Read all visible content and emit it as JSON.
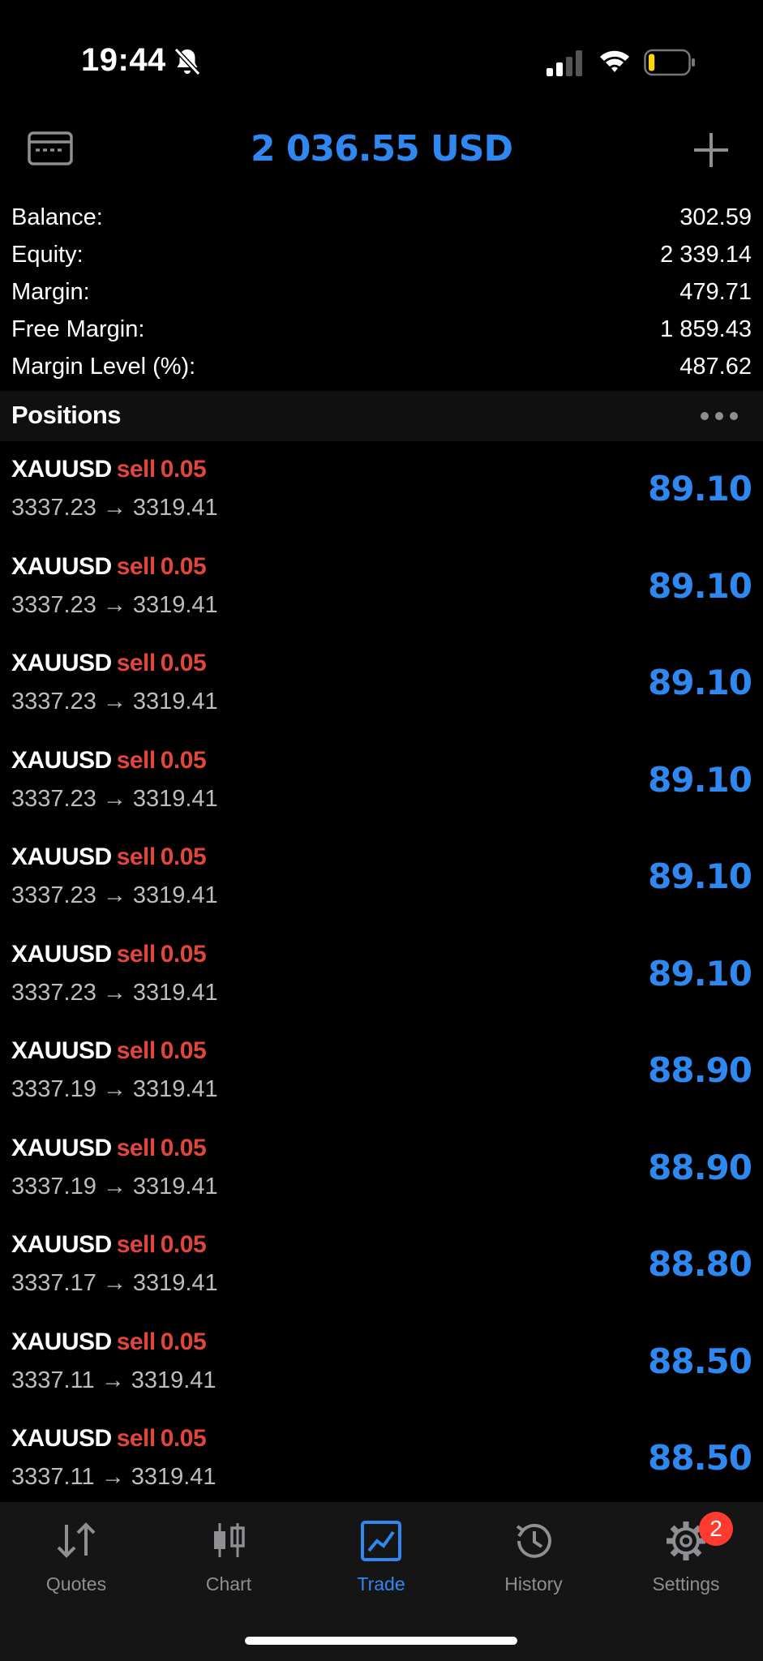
{
  "status_bar": {
    "time": "19:44"
  },
  "header": {
    "title": "2 036.55 USD"
  },
  "summary": [
    {
      "label": "Balance:",
      "value": "302.59"
    },
    {
      "label": "Equity:",
      "value": "2 339.14"
    },
    {
      "label": "Margin:",
      "value": "479.71"
    },
    {
      "label": "Free Margin:",
      "value": "1 859.43"
    },
    {
      "label": "Margin Level (%):",
      "value": "487.62"
    }
  ],
  "positions": {
    "title": "Positions",
    "arrow": "→",
    "items": [
      {
        "symbol": "XAUUSD",
        "side": "sell",
        "lot": "0.05",
        "open": "3337.23",
        "current": "3319.41",
        "profit": "89.10"
      },
      {
        "symbol": "XAUUSD",
        "side": "sell",
        "lot": "0.05",
        "open": "3337.23",
        "current": "3319.41",
        "profit": "89.10"
      },
      {
        "symbol": "XAUUSD",
        "side": "sell",
        "lot": "0.05",
        "open": "3337.23",
        "current": "3319.41",
        "profit": "89.10"
      },
      {
        "symbol": "XAUUSD",
        "side": "sell",
        "lot": "0.05",
        "open": "3337.23",
        "current": "3319.41",
        "profit": "89.10"
      },
      {
        "symbol": "XAUUSD",
        "side": "sell",
        "lot": "0.05",
        "open": "3337.23",
        "current": "3319.41",
        "profit": "89.10"
      },
      {
        "symbol": "XAUUSD",
        "side": "sell",
        "lot": "0.05",
        "open": "3337.23",
        "current": "3319.41",
        "profit": "89.10"
      },
      {
        "symbol": "XAUUSD",
        "side": "sell",
        "lot": "0.05",
        "open": "3337.19",
        "current": "3319.41",
        "profit": "88.90"
      },
      {
        "symbol": "XAUUSD",
        "side": "sell",
        "lot": "0.05",
        "open": "3337.19",
        "current": "3319.41",
        "profit": "88.90"
      },
      {
        "symbol": "XAUUSD",
        "side": "sell",
        "lot": "0.05",
        "open": "3337.17",
        "current": "3319.41",
        "profit": "88.80"
      },
      {
        "symbol": "XAUUSD",
        "side": "sell",
        "lot": "0.05",
        "open": "3337.11",
        "current": "3319.41",
        "profit": "88.50"
      },
      {
        "symbol": "XAUUSD",
        "side": "sell",
        "lot": "0.05",
        "open": "3337.11",
        "current": "3319.41",
        "profit": "88.50"
      }
    ]
  },
  "tabs": [
    {
      "label": "Quotes",
      "icon": "quotes-icon"
    },
    {
      "label": "Chart",
      "icon": "chart-icon"
    },
    {
      "label": "Trade",
      "icon": "trade-icon",
      "active": true
    },
    {
      "label": "History",
      "icon": "history-icon"
    },
    {
      "label": "Settings",
      "icon": "gear-icon",
      "badge": "2"
    }
  ],
  "colors": {
    "accent": "#2f87f0",
    "sell": "#e0463c",
    "badge": "#ff3b30",
    "battery_level": "#ffd60a"
  },
  "battery_level": 0.12
}
